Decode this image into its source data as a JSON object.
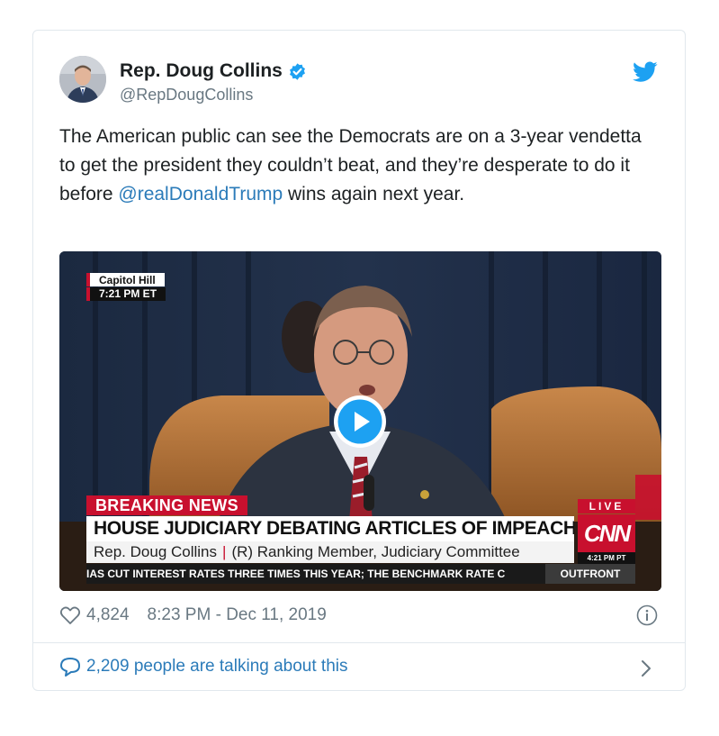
{
  "author": {
    "name": "Rep. Doug Collins",
    "handle": "@RepDougCollins"
  },
  "tweet": {
    "text_before": "The American public can see the Democrats are on a 3-year vendetta to get the president they couldn’t beat, and they’re desperate to do it before ",
    "mention": "@realDonaldTrump",
    "text_after": " wins again next year."
  },
  "media": {
    "location": "Capitol Hill",
    "location_time": "7:21 PM ET",
    "breaking": "BREAKING NEWS",
    "headline": "HOUSE JUDICIARY DEBATING ARTICLES OF IMPEACHMENT",
    "lower_name": "Rep. Doug Collins",
    "lower_title": "(R) Ranking Member, Judiciary Committee",
    "ticker": "IAS CUT INTEREST RATES THREE TIMES THIS YEAR; THE BENCHMARK RATE C",
    "show": "OUTFRONT",
    "live": "LIVE",
    "network": "CNN",
    "network_time": "4:21 PM PT"
  },
  "footer": {
    "likes": "4,824",
    "timestamp": "8:23 PM - Dec 11, 2019",
    "talking": "2,209 people are talking about this"
  },
  "colors": {
    "link": "#2b7bb9",
    "verified": "#1da1f2",
    "muted": "#697882",
    "cnn_red": "#c8102e"
  },
  "icons": [
    "verified-badge-icon",
    "twitter-bird-icon",
    "heart-icon",
    "info-icon",
    "comment-bubble-icon",
    "chevron-right-icon",
    "play-icon"
  ]
}
